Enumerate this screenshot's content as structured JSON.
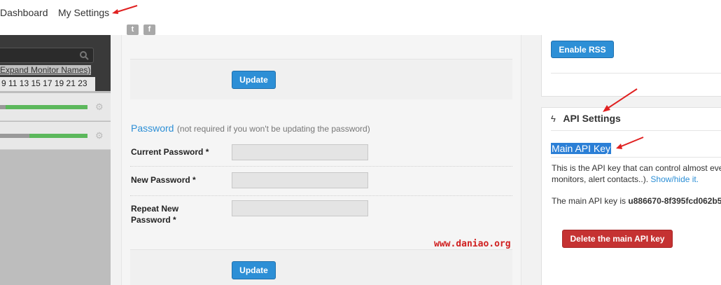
{
  "nav": {
    "dashboard": "Dashboard",
    "my_settings": "My Settings",
    "twitter": "t",
    "facebook": "f"
  },
  "sidebar": {
    "expand_link": "Expand Monitor Names)",
    "hours": "9  11 13 15 17 19 21 23"
  },
  "main": {
    "update_top": "Update",
    "password_heading": "Password",
    "password_note": "(not required if you won't be updating the password)",
    "current_password_label": "Current Password *",
    "new_password_label": "New Password *",
    "repeat_password_label_1": "Repeat New",
    "repeat_password_label_2": "Password *",
    "update_bottom": "Update",
    "watermark": "www.daniao.org"
  },
  "right": {
    "enable_rss": "Enable RSS",
    "api_heading": "API Settings",
    "main_api_key": "Main API Key",
    "desc_line1": "This is the API key that can control almost eve",
    "desc_line2": "monitors, alert contacts..).",
    "show_hide": "Show/hide it.",
    "key_prefix": "The main API key is ",
    "key_value": "u886670-8f395fcd062b5",
    "delete_button": "Delete the main API key"
  },
  "colors": {
    "accent_blue": "#2d8fd6",
    "danger_red": "#c53232",
    "selection": "#2b7fd6",
    "status_green": "#5cb85c"
  }
}
